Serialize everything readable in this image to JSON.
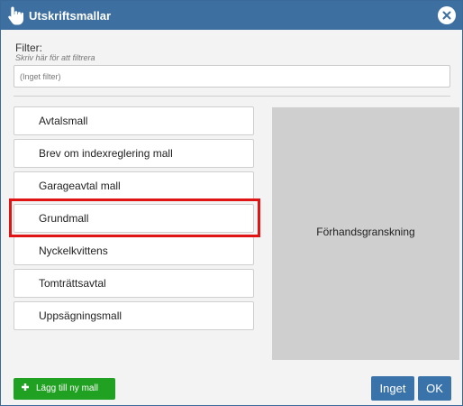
{
  "dialog": {
    "title": "Utskriftsmallar",
    "close_icon": "close-icon"
  },
  "filter": {
    "label": "Filter:",
    "hint": "Skriv här för att filtrera",
    "placeholder": "(Inget filter)",
    "value": ""
  },
  "templates": [
    {
      "label": "Avtalsmall"
    },
    {
      "label": "Brev om indexreglering mall"
    },
    {
      "label": "Garageavtal mall"
    },
    {
      "label": "Grundmall"
    },
    {
      "label": "Nyckelkvittens"
    },
    {
      "label": "Tomträttsavtal"
    },
    {
      "label": "Uppsägningsmall"
    }
  ],
  "selected_template": "Grundmall",
  "preview": {
    "label": "Förhandsgranskning"
  },
  "footer": {
    "add_label": "Lägg till ny mall",
    "none_label": "Inget",
    "ok_label": "OK"
  },
  "colors": {
    "titlebar": "#3d6fa1",
    "primary_button": "#3a73aa",
    "add_button": "#21a121",
    "selection_frame": "#e01414",
    "preview_bg": "#cfcfcf"
  }
}
